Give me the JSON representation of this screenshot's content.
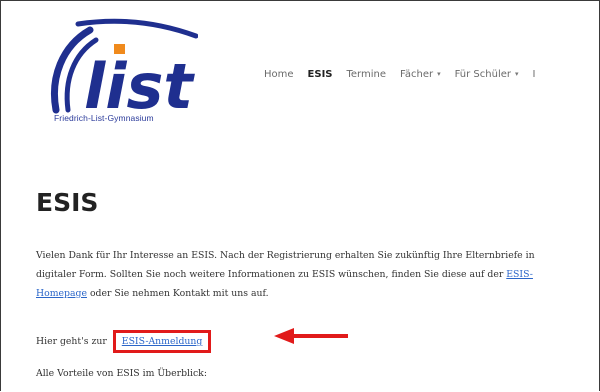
{
  "logo": {
    "text": "list",
    "subtitle": "Friedrich-List-Gymnasium",
    "colors": {
      "navy": "#1f2f8f",
      "orange": "#f08a1c"
    }
  },
  "nav": {
    "items": [
      {
        "label": "Home",
        "active": false,
        "dropdown": false
      },
      {
        "label": "ESIS",
        "active": true,
        "dropdown": false
      },
      {
        "label": "Termine",
        "active": false,
        "dropdown": false
      },
      {
        "label": "Fächer",
        "active": false,
        "dropdown": true
      },
      {
        "label": "Für Schüler",
        "active": false,
        "dropdown": true
      },
      {
        "label": "I",
        "active": false,
        "dropdown": false
      }
    ],
    "chevron_icon": "chevron-down-icon"
  },
  "content": {
    "title": "ESIS",
    "para_part1": "Vielen Dank für Ihr Interesse an ESIS. Nach der Registrierung erhalten Sie zukünftig Ihre Elternbriefe in digitaler Form. Sollten Sie noch weitere Informationen zu ESIS wünschen, finden Sie diese auf der ",
    "para_link": "ESIS-Homepage",
    "para_part2": " oder Sie nehmen Kontakt mit uns auf.",
    "register_prefix": "Hier geht's zur",
    "register_link": "ESIS-Anmeldung",
    "advantages_text": "Alle Vorteile von ESIS im Überblick:"
  },
  "annotations": {
    "highlight_color": "#e11a1a",
    "arrow_icon": "left-arrow-icon"
  }
}
